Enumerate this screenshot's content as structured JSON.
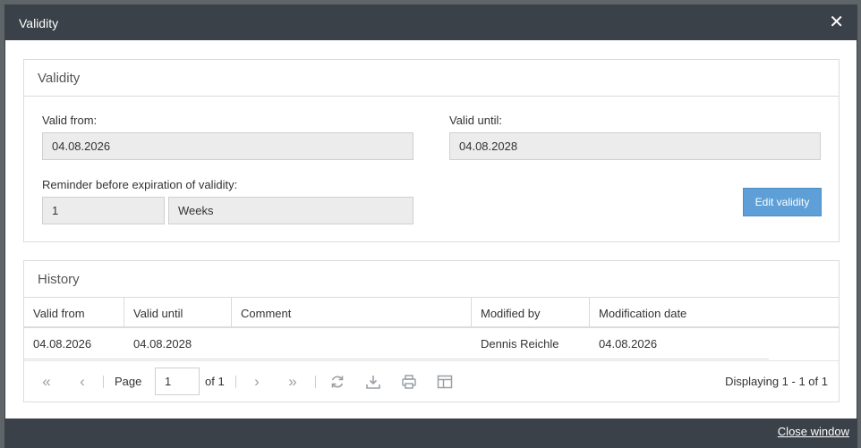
{
  "window": {
    "title": "Validity",
    "close_icon": "close-icon"
  },
  "validity": {
    "heading": "Validity",
    "valid_from_label": "Valid from:",
    "valid_from_value": "04.08.2026",
    "valid_until_label": "Valid until:",
    "valid_until_value": "04.08.2028",
    "reminder_label": "Reminder before expiration of validity:",
    "reminder_amount": "1",
    "reminder_unit": "Weeks",
    "edit_button": "Edit validity"
  },
  "history": {
    "heading": "History",
    "columns": [
      "Valid from",
      "Valid until",
      "Comment",
      "Modified by",
      "Modification date"
    ],
    "rows": [
      [
        "04.08.2026",
        "04.08.2028",
        "",
        "Dennis Reichle",
        "04.08.2026"
      ]
    ],
    "pager": {
      "page_label": "Page",
      "page_value": "1",
      "of_label": "of 1",
      "display_text": "Displaying 1 - 1 of 1"
    }
  },
  "footer": {
    "close_link": "Close window"
  },
  "colors": {
    "titlebar": "#3a4148",
    "button": "#5d9fd6"
  }
}
